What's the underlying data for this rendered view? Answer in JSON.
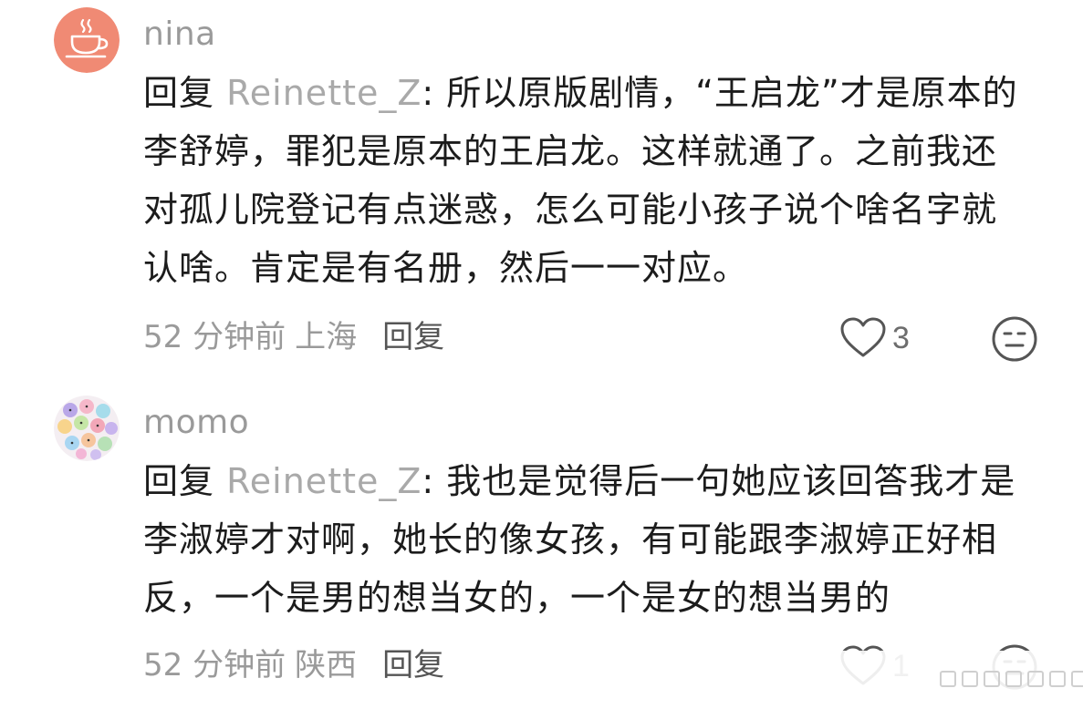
{
  "comments": [
    {
      "username": "nina",
      "avatar_icon": "teacup-icon",
      "avatar_color": "#f08a74",
      "reply_prefix": "回复 ",
      "reply_target": "Reinette_Z",
      "reply_colon": ": ",
      "text": "所以原版剧情，“王启龙”才是原本的李舒婷，罪犯是原本的王启龙。这样就通了。之前我还对孤儿院登记有点迷惑，怎么可能小孩子说个啥名字就认啥。肯定是有名册，然后一一对应。",
      "time": "52 分钟前",
      "location": "上海",
      "reply_label": "回复",
      "likes": "3"
    },
    {
      "username": "momo",
      "avatar_icon": "sticker-collage-icon",
      "reply_prefix": "回复 ",
      "reply_target": "Reinette_Z",
      "reply_colon": ": ",
      "text": "我也是觉得后一句她应该回答我才是李淑婷才对啊，她长的像女孩，有可能跟李淑婷正好相反，一个是男的想当女的，一个是女的想当男的",
      "time": "52 分钟前",
      "location": "陕西",
      "reply_label": "回复",
      "likes": "1"
    }
  ],
  "icons": {
    "like": "heart-outline-icon",
    "dislike": "meh-face-icon"
  }
}
